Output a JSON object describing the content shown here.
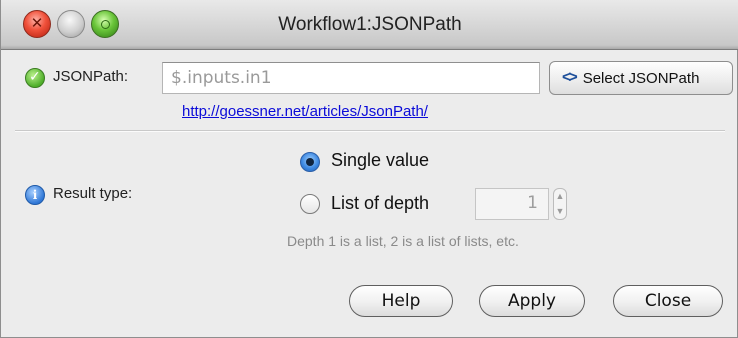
{
  "window": {
    "title": "Workflow1:JSONPath"
  },
  "jsonpath": {
    "label": "JSONPath:",
    "value": "$.inputs.in1",
    "select_button_label": "Select JSONPath",
    "help_link": "http://goessner.net/articles/JsonPath/",
    "status_icon": "check-circle-icon"
  },
  "result_type": {
    "label": "Result type:",
    "info_icon": "info-icon",
    "options": [
      {
        "label": "Single value",
        "selected": true
      },
      {
        "label": "List of depth",
        "selected": false
      }
    ],
    "depth_value": "1",
    "hint": "Depth 1 is a list, 2 is a list of lists, etc."
  },
  "buttons": {
    "help": "Help",
    "apply": "Apply",
    "close": "Close"
  },
  "colors": {
    "link": "#0b0bd8",
    "accent": "#3b86e0"
  }
}
